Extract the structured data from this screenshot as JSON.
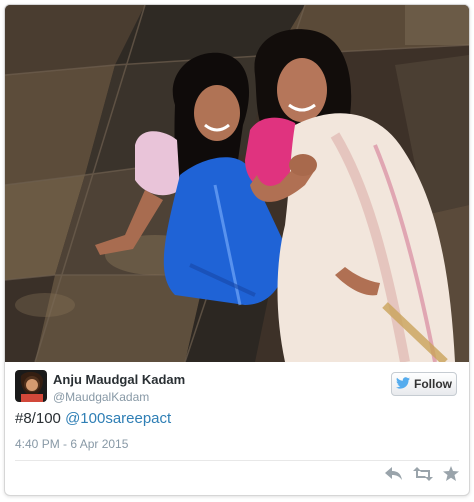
{
  "tweet": {
    "author_name": "Anju Maudgal Kadam",
    "author_handle": "@MaudgalKadam",
    "text_prefix": "#8/100",
    "mention": "@100sareepact",
    "timestamp": "4:40 PM - 6 Apr 2015"
  },
  "follow_button": {
    "label": "Follow",
    "icon": "twitter-bird-icon"
  },
  "actions": [
    {
      "name": "reply-icon"
    },
    {
      "name": "retweet-icon"
    },
    {
      "name": "favorite-icon"
    }
  ],
  "colors": {
    "link": "#2f7fb5",
    "twitter_blue": "#55acee",
    "text": "#292f33",
    "muted": "#8899a6"
  }
}
